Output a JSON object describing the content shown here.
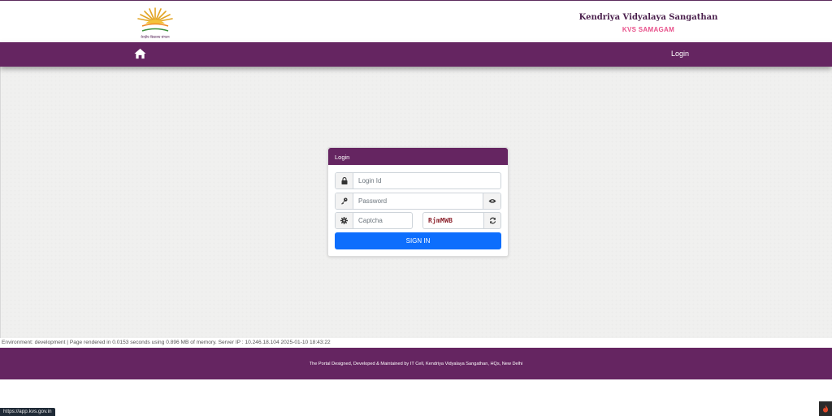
{
  "header": {
    "org_title": "Kendriya Vidyalaya Sangathan",
    "org_subtitle": "KVS SAMAGAM",
    "logo_icon": "kvs-sun-logo-icon",
    "logo_caption": "केन्द्रीय विद्यालय संगठन"
  },
  "navbar": {
    "home_icon": "home-icon",
    "login_label": "Login"
  },
  "login_card": {
    "title": "Login",
    "login_id_placeholder": "Login Id",
    "password_placeholder": "Password",
    "captcha_placeholder": "Captcha",
    "captcha_text": "RjmMWB",
    "signin_label": "SIGN IN",
    "icons": {
      "login_id": "lock-icon",
      "password": "key-icon",
      "password_toggle": "eye-icon",
      "captcha": "gear-icon",
      "refresh": "refresh-icon"
    }
  },
  "environment_text": "Environment: development | Page rendered in 0.0153 seconds using 0.896 MB of memory. Server IP : 10.246.18.104 2025-01-10 18:43:22",
  "footer_text": "The Portal Designed, Developed & Maintained by IT Cell, Kendriya Vidyalaya Sangathan, HQs, New Delhi",
  "status_bar_url": "https://app.kvs.gov.in",
  "colors": {
    "brand_purple": "#652561",
    "accent_pink": "#e8508a",
    "primary_blue": "#0d6efd"
  }
}
